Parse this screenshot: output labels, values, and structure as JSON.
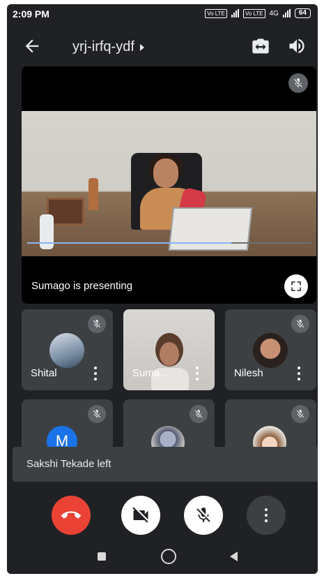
{
  "status_bar": {
    "time": "2:09 PM",
    "network1": "Vo LTE",
    "network2": "4G",
    "battery": "64"
  },
  "header": {
    "meeting_code": "yrj-irfq-ydf"
  },
  "presentation": {
    "caption": "Sumago is presenting",
    "seek_progress": 0.72
  },
  "participants": [
    {
      "name": "Shital"
    },
    {
      "name": "Suma..."
    },
    {
      "name": "Nilesh"
    },
    {
      "name": "",
      "avatar_letter": "M"
    },
    {
      "name": ""
    },
    {
      "name": ""
    }
  ],
  "toast": {
    "text": "Sakshi Tekade left"
  },
  "colors": {
    "background": "#202124",
    "tile": "#3c4043",
    "end_call": "#ea4335",
    "accent": "#1a73e8"
  },
  "icons": [
    "back-arrow-icon",
    "switch-camera-icon",
    "speaker-icon",
    "mic-off-icon",
    "fullscreen-icon",
    "more-vert-icon",
    "end-call-icon",
    "camera-off-icon",
    "nav-square-icon",
    "nav-home-icon",
    "nav-back-icon"
  ]
}
